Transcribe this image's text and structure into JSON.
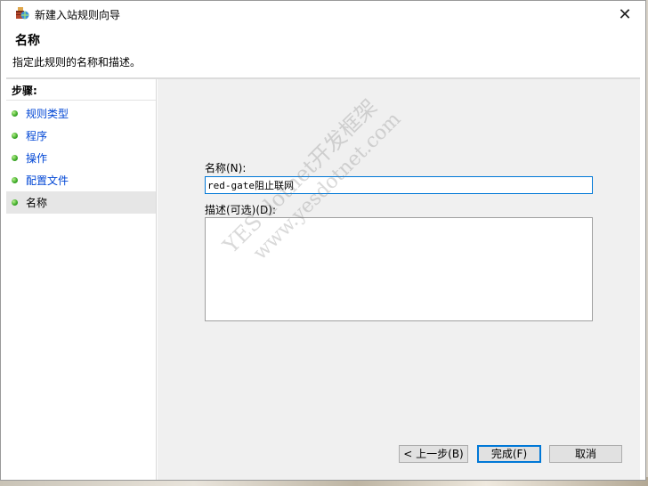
{
  "window": {
    "title": "新建入站规则向导",
    "close_label": "✕"
  },
  "header": {
    "title": "名称",
    "description": "指定此规则的名称和描述。"
  },
  "sidebar": {
    "title": "步骤:",
    "items": [
      {
        "label": "规则类型"
      },
      {
        "label": "程序"
      },
      {
        "label": "操作"
      },
      {
        "label": "配置文件"
      },
      {
        "label": "名称"
      }
    ]
  },
  "form": {
    "name_label": "名称(N):",
    "name_value": "red-gate阻止联网",
    "description_label": "描述(可选)(D):",
    "description_value": ""
  },
  "buttons": {
    "back": "< 上一步(B)",
    "finish": "完成(F)",
    "cancel": "取消"
  },
  "watermark": {
    "line1": "YES dotnet开发框架",
    "line2": "www.yesdotnet.com"
  }
}
